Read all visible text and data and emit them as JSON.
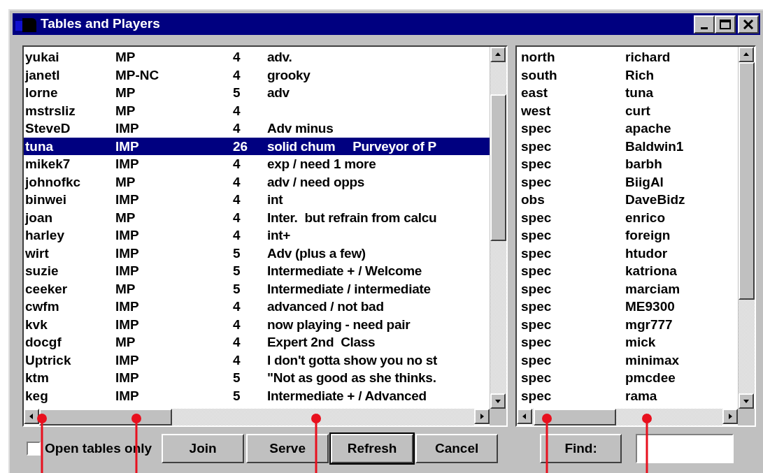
{
  "window": {
    "title": "Tables and Players"
  },
  "tables": [
    {
      "name": "yukai",
      "scoring": "MP",
      "count": "4",
      "note": "adv.",
      "selected": false
    },
    {
      "name": "janetl",
      "scoring": "MP-NC",
      "count": "4",
      "note": "grooky",
      "selected": false
    },
    {
      "name": "lorne",
      "scoring": "MP",
      "count": "5",
      "note": "adv",
      "selected": false
    },
    {
      "name": "mstrsliz",
      "scoring": "MP",
      "count": "4",
      "selected": false
    },
    {
      "name": "SteveD",
      "scoring": "IMP",
      "count": "4",
      "note": "Adv minus",
      "selected": false
    },
    {
      "name": "tuna",
      "scoring": "IMP",
      "count": "26",
      "note": "solid chum     Purveyor of P",
      "selected": true
    },
    {
      "name": "mikek7",
      "scoring": "IMP",
      "count": "4",
      "note": "exp / need 1 more",
      "selected": false
    },
    {
      "name": "johnofkc",
      "scoring": "MP",
      "count": "4",
      "note": "adv / need opps",
      "selected": false
    },
    {
      "name": "binwei",
      "scoring": "IMP",
      "count": "4",
      "note": "int",
      "selected": false
    },
    {
      "name": "joan",
      "scoring": "MP",
      "count": "4",
      "note": "Inter.  but refrain from calcu",
      "selected": false
    },
    {
      "name": "harley",
      "scoring": "IMP",
      "count": "4",
      "note": "int+",
      "selected": false
    },
    {
      "name": "wirt",
      "scoring": "IMP",
      "count": "5",
      "note": "Adv (plus a few)",
      "selected": false
    },
    {
      "name": "suzie",
      "scoring": "IMP",
      "count": "5",
      "note": "Intermediate + / Welcome",
      "selected": false
    },
    {
      "name": "ceeker",
      "scoring": "MP",
      "count": "5",
      "note": "Intermediate / intermediate",
      "selected": false
    },
    {
      "name": "cwfm",
      "scoring": "IMP",
      "count": "4",
      "note": "advanced / not bad",
      "selected": false
    },
    {
      "name": "kvk",
      "scoring": "IMP",
      "count": "4",
      "note": "now playing - need pair",
      "selected": false
    },
    {
      "name": "docgf",
      "scoring": "MP",
      "count": "4",
      "note": "Expert 2nd  Class",
      "selected": false
    },
    {
      "name": "Uptrick",
      "scoring": "IMP",
      "count": "4",
      "note": "I don't gotta show you no st",
      "selected": false
    },
    {
      "name": "ktm",
      "scoring": "IMP",
      "count": "5",
      "note": "\"Not as good as she thinks.",
      "selected": false
    },
    {
      "name": "keg",
      "scoring": "IMP",
      "count": "5",
      "note": "Intermediate + / Advanced",
      "selected": false
    }
  ],
  "players": [
    {
      "seat": "north",
      "player": "richard"
    },
    {
      "seat": "south",
      "player": "Rich"
    },
    {
      "seat": "east",
      "player": "tuna"
    },
    {
      "seat": "west",
      "player": "curt"
    },
    {
      "seat": "spec",
      "player": "apache"
    },
    {
      "seat": "spec",
      "player": "Baldwin1"
    },
    {
      "seat": "spec",
      "player": "barbh"
    },
    {
      "seat": "spec",
      "player": "BiigAl"
    },
    {
      "seat": "obs",
      "player": "DaveBidz"
    },
    {
      "seat": "spec",
      "player": "enrico"
    },
    {
      "seat": "spec",
      "player": "foreign"
    },
    {
      "seat": "spec",
      "player": "htudor"
    },
    {
      "seat": "spec",
      "player": "katriona"
    },
    {
      "seat": "spec",
      "player": "marciam"
    },
    {
      "seat": "spec",
      "player": "ME9300"
    },
    {
      "seat": "spec",
      "player": "mgr777"
    },
    {
      "seat": "spec",
      "player": "mick"
    },
    {
      "seat": "spec",
      "player": "minimax"
    },
    {
      "seat": "spec",
      "player": "pmcdee"
    },
    {
      "seat": "spec",
      "player": "rama"
    }
  ],
  "open_tables_only": {
    "label": "Open tables only",
    "checked": false
  },
  "buttons": [
    "Join",
    "Serve",
    "Refresh",
    "Cancel"
  ],
  "find": {
    "label": "Find:"
  }
}
